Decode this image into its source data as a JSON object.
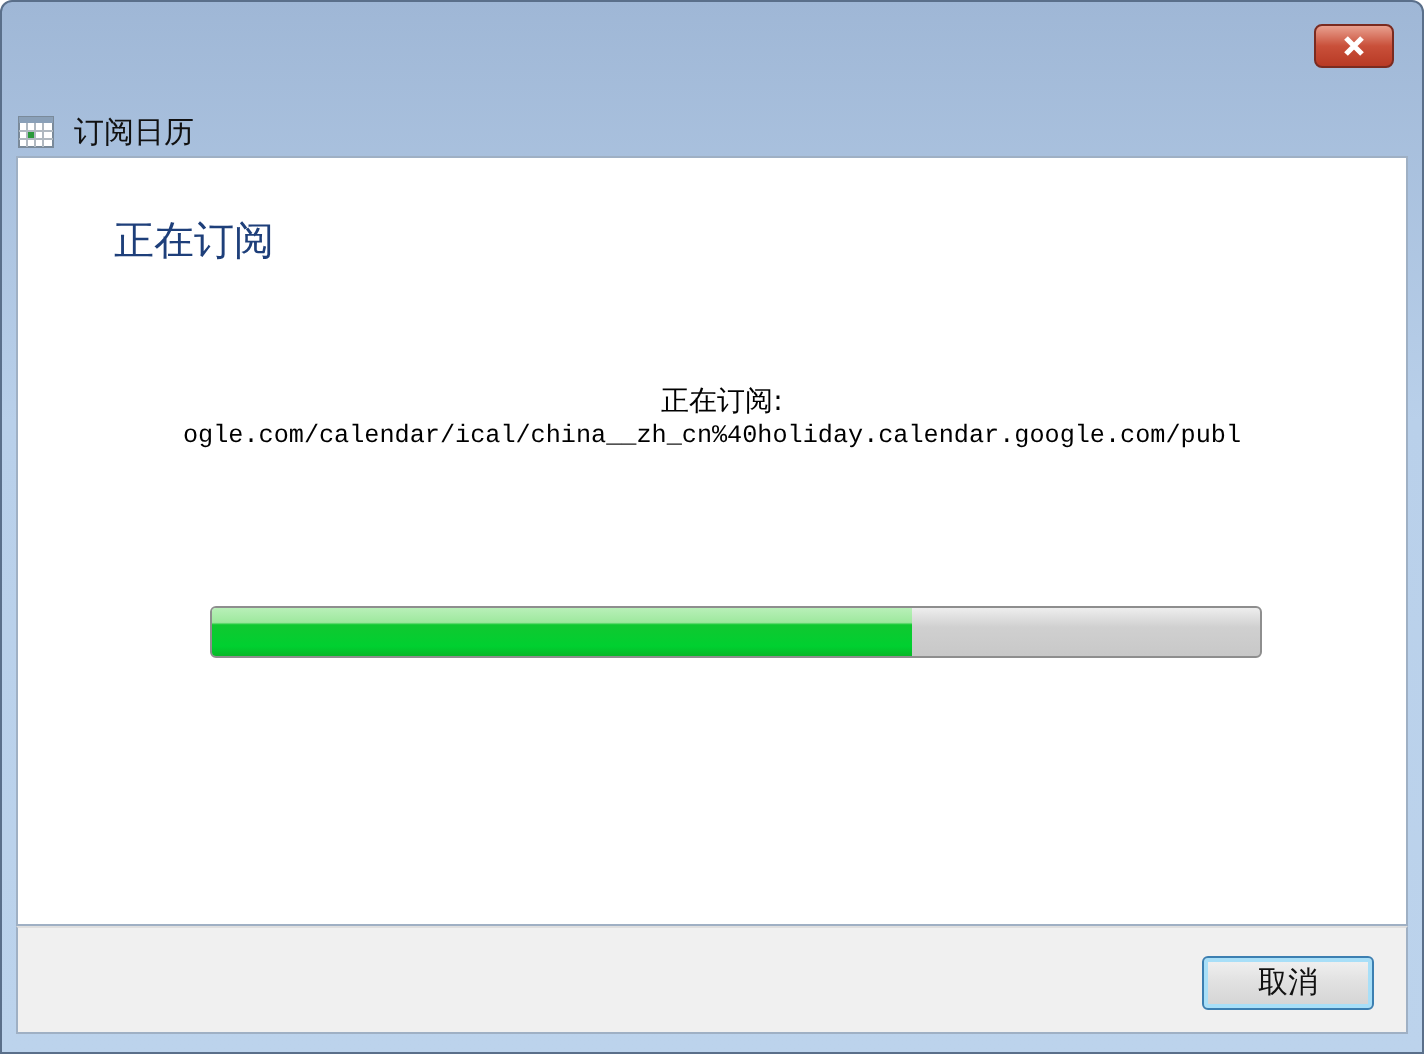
{
  "window": {
    "title": "订阅日历"
  },
  "heading": "正在订阅",
  "status_label": "正在订阅:",
  "url": "ogle.com/calendar/ical/china__zh_cn%40holiday.calendar.google.com/publ",
  "progress": {
    "level": 0.667
  },
  "buttons": [
    "取消"
  ]
}
